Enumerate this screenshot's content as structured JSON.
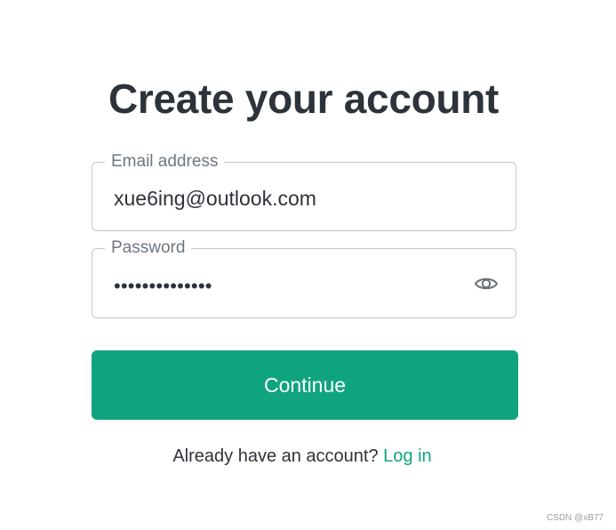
{
  "page": {
    "title": "Create your account"
  },
  "email_field": {
    "label": "Email address",
    "value": "xue6ing@outlook.com"
  },
  "password_field": {
    "label": "Password",
    "masked_value": "••••••••••••••",
    "toggle_icon": "eye-icon"
  },
  "continue_button": {
    "label": "Continue"
  },
  "footer": {
    "prompt": "Already have an account?",
    "login_link": "Log in"
  },
  "watermark": {
    "text": "CSDN @xB77"
  },
  "colors": {
    "accent": "#10a37f",
    "text": "#2d333a",
    "label": "#6f7780",
    "border": "#c2c8d0"
  }
}
